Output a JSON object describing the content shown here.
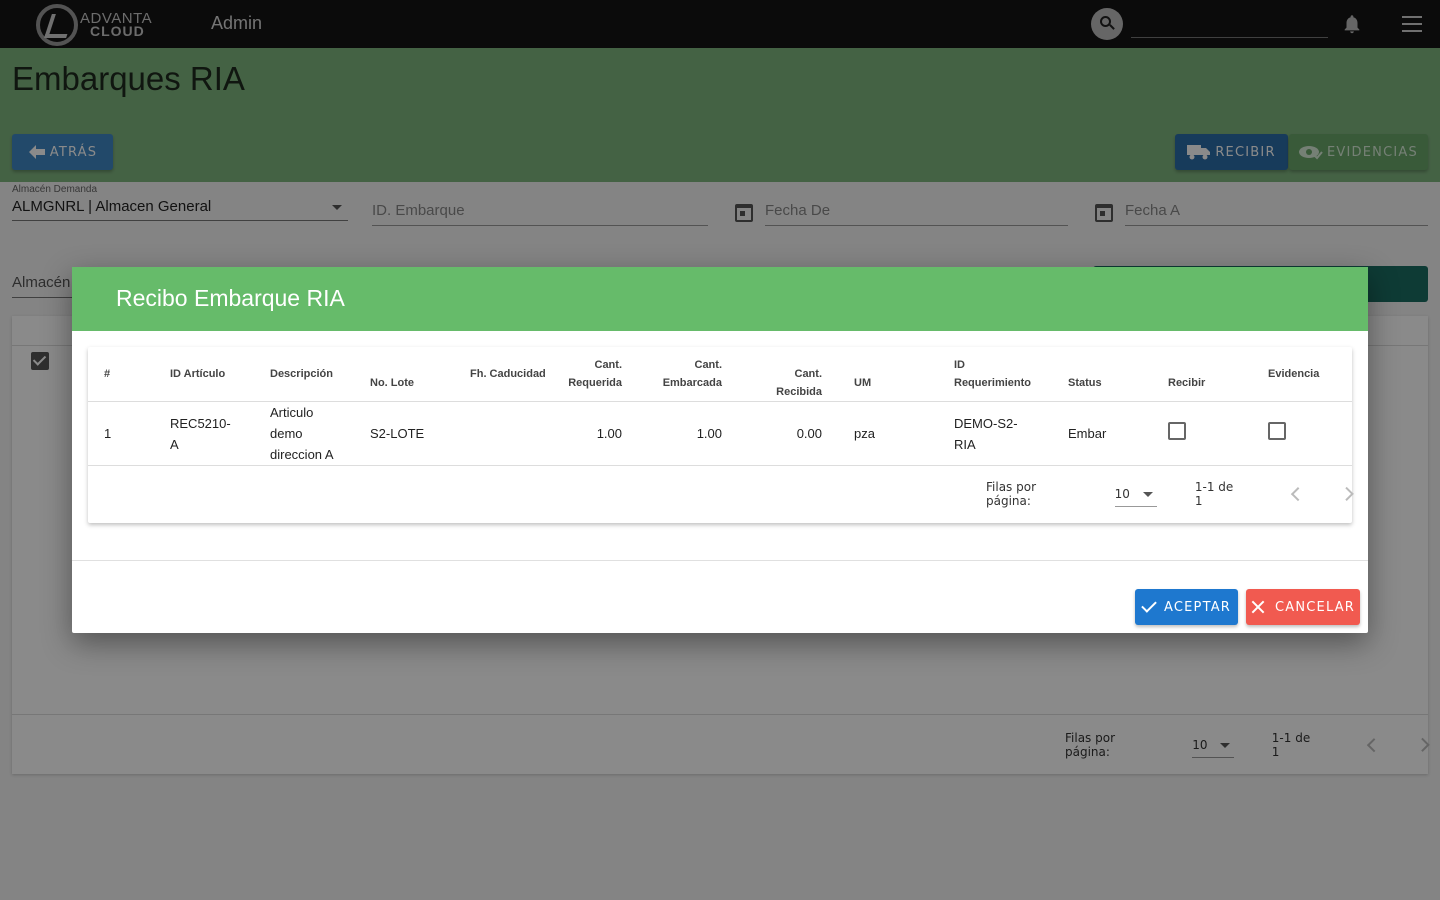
{
  "topbar": {
    "logo_line1": "ADVANTA",
    "logo_line2": "CLOUD",
    "app_title": "Admin",
    "search_placeholder": ""
  },
  "page": {
    "title": "Embarques RIA",
    "back_label": "Atrás",
    "recibir_label": "Recibir",
    "evidencias_label": "Evidencias"
  },
  "filters": {
    "almacen_demanda_label": "Almacén Demanda",
    "almacen_demanda_value": "ALMGNRL | Almacen General",
    "id_embarque_placeholder": "ID. Embarque",
    "fecha_de_placeholder": "Fecha De",
    "fecha_a_placeholder": "Fecha A",
    "almacen_surtidor_partial": "Almacén Su"
  },
  "bg_table": {
    "pager": {
      "rows_label": "Filas por página:",
      "rows_value": "10",
      "range": "1-1 de 1"
    }
  },
  "modal": {
    "title": "Recibo Embarque RIA",
    "columns": [
      {
        "key": "num",
        "label": "#"
      },
      {
        "key": "id_articulo",
        "label": "ID Artículo"
      },
      {
        "key": "descripcion",
        "label": "Descripción"
      },
      {
        "key": "no_lote",
        "label": "No. Lote"
      },
      {
        "key": "fh_caducidad",
        "label": "Fh. Caducidad"
      },
      {
        "key": "cant_requerida",
        "label": "Cant. Requerida"
      },
      {
        "key": "cant_embarcada",
        "label": "Cant. Embarcada"
      },
      {
        "key": "cant_recibida",
        "label": "Cant. Recibida"
      },
      {
        "key": "um",
        "label": "UM"
      },
      {
        "key": "id_requerimiento",
        "label": "ID Requerimiento"
      },
      {
        "key": "status",
        "label": "Status"
      },
      {
        "key": "recibir",
        "label": "Recibir"
      },
      {
        "key": "evidencia",
        "label": "Evidencia"
      }
    ],
    "rows": [
      {
        "num": "1",
        "id_articulo": "REC5210-A",
        "descripcion": "Articulo demo direccion A",
        "no_lote": "S2-LOTE",
        "fh_caducidad": "",
        "cant_requerida": "1.00",
        "cant_embarcada": "1.00",
        "cant_recibida": "0.00",
        "um": "pza",
        "id_requerimiento": "DEMO-S2-RIA",
        "status": "Embar",
        "recibir": false,
        "evidencia": false
      }
    ],
    "pager": {
      "rows_label": "Filas por página:",
      "rows_value": "10",
      "range": "1-1 de 1"
    },
    "accept_label": "Aceptar",
    "cancel_label": "Cancelar"
  },
  "colors": {
    "topbar": "#161616",
    "header_green": "#7fb57f",
    "modal_green": "#66bb6a",
    "primary_blue": "#1e78cf",
    "cancel_red": "#f15a50"
  }
}
